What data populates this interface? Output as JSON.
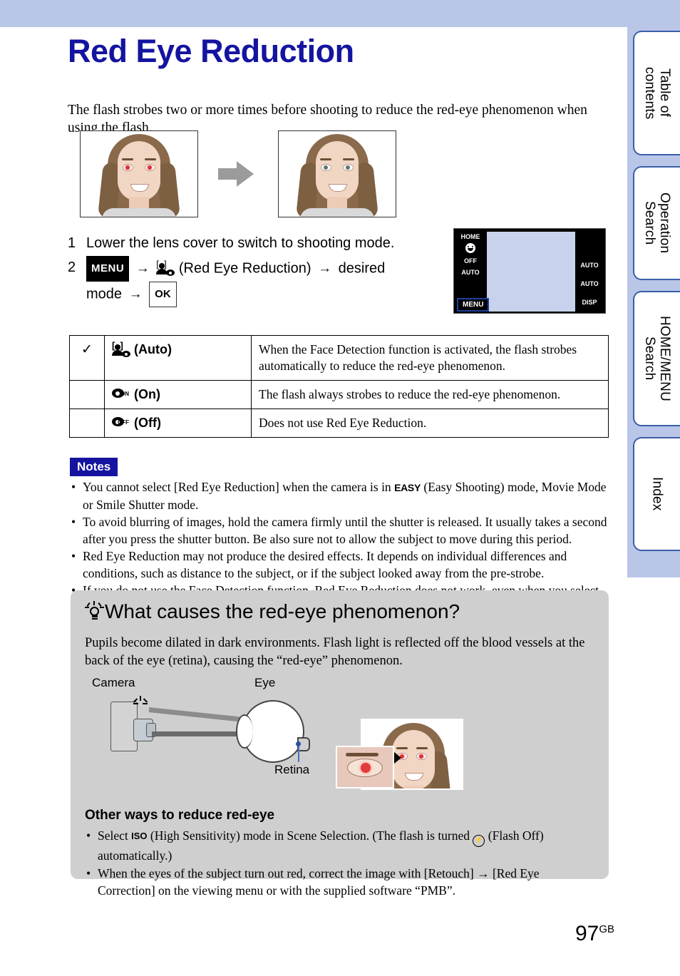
{
  "page": {
    "title": "Red Eye Reduction",
    "intro": "The flash strobes two or more times before shooting to reduce the red-eye phenomenon when using the flash.",
    "number": "97",
    "number_suffix": "GB"
  },
  "tabs": [
    {
      "label": "Table of\ncontents"
    },
    {
      "label": "Operation\nSearch"
    },
    {
      "label": "HOME/MENU\nSearch"
    },
    {
      "label": "Index"
    }
  ],
  "steps": [
    {
      "num": "1",
      "text": "Lower the lens cover to switch to shooting mode."
    },
    {
      "num": "2",
      "menu_label": "MENU",
      "arrow1": "→",
      "icon_label": "(Red Eye Reduction)",
      "arrow2": "→",
      "desired": "desired",
      "mode": "mode",
      "arrow3": "→",
      "ok_label": "OK"
    }
  ],
  "lcd": {
    "home": "HOME",
    "smile": "smile-shutter-icon",
    "selftimer": "OFF",
    "focus": "AUTO",
    "menu": "MENU",
    "flash": "AUTO",
    "macro": "AUTO",
    "disp": "DISP"
  },
  "options": {
    "rows": [
      {
        "checked": "✓",
        "name": "(Auto)",
        "sub": "",
        "description": "When the Face Detection function is activated, the flash strobes automatically to reduce the red-eye phenomenon."
      },
      {
        "checked": "",
        "name": "(On)",
        "sub": "ON",
        "description": "The flash always strobes to reduce the red-eye phenomenon."
      },
      {
        "checked": "",
        "name": "(Off)",
        "sub": "OFF",
        "description": "Does not use Red Eye Reduction."
      }
    ]
  },
  "notes": {
    "badge": "Notes",
    "items": [
      {
        "pre": "You cannot select [Red Eye Reduction] when the camera is in ",
        "icon": "EASY",
        "post": " (Easy Shooting) mode, Movie Mode or Smile Shutter mode."
      },
      {
        "pre": "To avoid blurring of images, hold the camera firmly until the shutter is released. It usually takes a second after you press the shutter button. Be also sure not to allow the subject to move during this period.",
        "icon": "",
        "post": ""
      },
      {
        "pre": "Red Eye Reduction may not produce the desired effects. It depends on individual differences and conditions, such as distance to the subject, or if the subject looked away from the pre-strobe.",
        "icon": "",
        "post": ""
      },
      {
        "pre": "If you do not use the Face Detection function, Red Eye Reduction does not work, even when you select [Auto].",
        "icon": "",
        "post": ""
      }
    ]
  },
  "tip": {
    "heading": "What causes the red-eye phenomenon?",
    "body": "Pupils become dilated in dark environments. Flash light is reflected off the blood vessels at the back of the eye (retina), causing the “red-eye” phenomenon.",
    "diagram": {
      "camera_label": "Camera",
      "eye_label": "Eye",
      "retina_label": "Retina"
    },
    "other_heading": "Other ways to reduce red-eye",
    "other_items": [
      {
        "pre": "Select ",
        "icon": "ISO",
        "mid": " (High Sensitivity) mode in Scene Selection. (The flash is turned ",
        "icon2": "flash-off-icon",
        "post": " (Flash Off) automatically.)"
      },
      {
        "pre": "When the eyes of the subject turn out red, correct the image with [Retouch] → [Red Eye Correction] on the viewing menu or with the supplied software “PMB”.",
        "icon": "",
        "mid": "",
        "icon2": "",
        "post": ""
      }
    ]
  }
}
